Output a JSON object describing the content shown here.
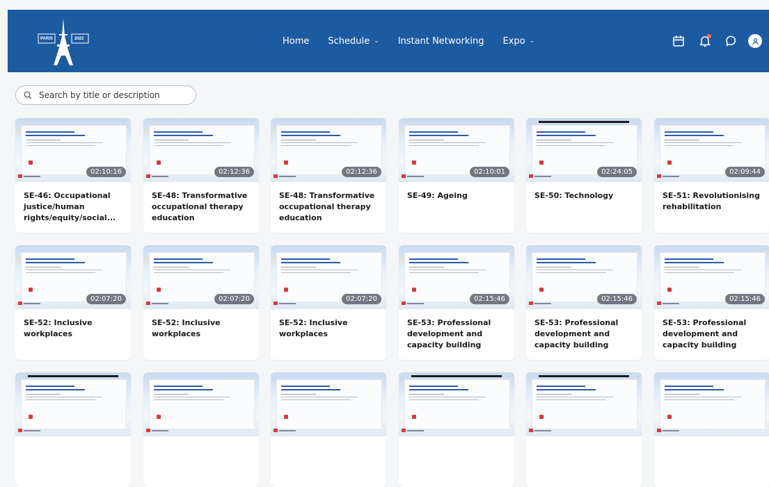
{
  "header": {
    "logo": {
      "left_text": "PARIS",
      "right_text": "2022"
    },
    "nav": [
      {
        "label": "Home",
        "has_dropdown": false
      },
      {
        "label": "Schedule",
        "has_dropdown": true
      },
      {
        "label": "Instant Networking",
        "has_dropdown": false
      },
      {
        "label": "Expo",
        "has_dropdown": true
      }
    ],
    "icons": [
      "calendar-icon",
      "bell-icon",
      "chat-icon",
      "user-icon"
    ]
  },
  "search": {
    "placeholder": "Search by title or description"
  },
  "cards": [
    {
      "title": "SE-46: Occupational justice/human rights/equity/social...",
      "duration": "02:10:16"
    },
    {
      "title": "SE-48: Transformative occupational therapy education",
      "duration": "02:12:36"
    },
    {
      "title": "SE-48: Transformative occupational therapy education",
      "duration": "02:12:36"
    },
    {
      "title": "SE-49: Ageing",
      "duration": "02:10:01"
    },
    {
      "title": "SE-50: Technology",
      "duration": "02:24:05"
    },
    {
      "title": "SE-51: Revolutionising rehabilitation",
      "duration": "02:09:44"
    },
    {
      "title": "SE-52: Inclusive workplaces",
      "duration": "02:07:20"
    },
    {
      "title": "SE-52: Inclusive workplaces",
      "duration": "02:07:20"
    },
    {
      "title": "SE-52: Inclusive workplaces",
      "duration": "02:07:20"
    },
    {
      "title": "SE-53: Professional development and capacity building",
      "duration": "02:15:46"
    },
    {
      "title": "SE-53: Professional development and capacity building",
      "duration": "02:15:46"
    },
    {
      "title": "SE-53: Professional development and capacity building",
      "duration": "02:15:46"
    },
    {
      "title": "",
      "duration": ""
    },
    {
      "title": "",
      "duration": ""
    },
    {
      "title": "",
      "duration": ""
    },
    {
      "title": "",
      "duration": ""
    },
    {
      "title": "",
      "duration": ""
    },
    {
      "title": "",
      "duration": ""
    }
  ],
  "colors": {
    "header_bg": "#1d5ba1",
    "notification_dot": "#ff6b4a"
  }
}
